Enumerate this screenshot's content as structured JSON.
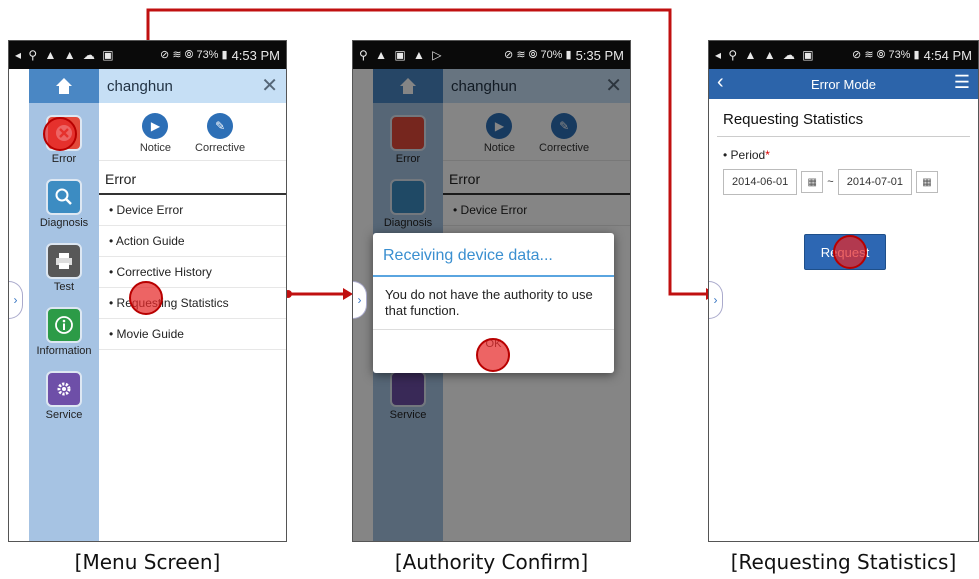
{
  "status_bar": {
    "screen1": {
      "icons_left": "◂ ⚲ ▲ ▲ ☁ ▣",
      "icons_right": "⊘ ≋ ⦾ 73% ▮",
      "time": "4:53 PM"
    },
    "screen2": {
      "icons_left": "⚲ ▲ ▣ ▲ ▷",
      "icons_right": "⊘ ≋ ⦾ 70% ▮",
      "time": "5:35 PM"
    },
    "screen3": {
      "icons_left": "◂ ⚲ ▲ ▲ ☁ ▣",
      "icons_right": "⊘ ≋ ⦾ 73% ▮",
      "time": "4:54 PM"
    }
  },
  "menu": {
    "user": "changhun",
    "sidebar": [
      {
        "label": "Error",
        "icon": "error-icon",
        "color": "#e34a3b"
      },
      {
        "label": "Diagnosis",
        "icon": "search-icon",
        "color": "#3c8cc2"
      },
      {
        "label": "Test",
        "icon": "printer-icon",
        "color": "#585858"
      },
      {
        "label": "Information",
        "icon": "info-icon",
        "color": "#2c9b47"
      },
      {
        "label": "Service",
        "icon": "gear-icon",
        "color": "#6e4fa8"
      }
    ],
    "quick_links": [
      {
        "label": "Notice",
        "icon": "notice-icon"
      },
      {
        "label": "Corrective",
        "icon": "corrective-icon"
      }
    ],
    "section_title": "Error",
    "items": [
      "Device Error",
      "Action Guide",
      "Corrective History",
      "Requesting Statistics",
      "Movie Guide"
    ]
  },
  "dialog": {
    "title": "Receiving device data...",
    "message": "You do not have the authority to use that function.",
    "ok": "OK"
  },
  "stats": {
    "app_title": "Error Mode",
    "page_title": "Requesting Statistics",
    "period_label": "• Period",
    "required_mark": "*",
    "start_date": "2014-06-01",
    "separator": "~",
    "end_date": "2014-07-01",
    "request_button": "Request"
  },
  "captions": [
    "[Menu Screen]",
    "[Authority Confirm]",
    "[Requesting Statistics]"
  ],
  "colors": {
    "flow_arrow": "#c01010",
    "accent": "#2c64aa",
    "touch": "#d82020"
  }
}
